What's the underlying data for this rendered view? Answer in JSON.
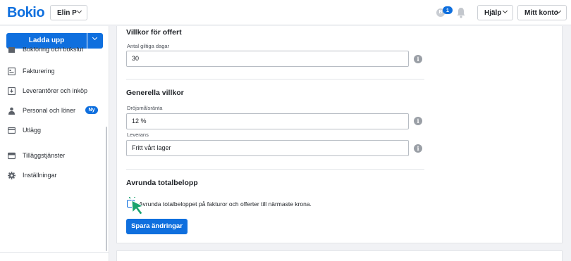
{
  "header": {
    "logo": "Bokio",
    "user": "Elin P",
    "coin_symbol": "B",
    "notification_count": "1",
    "help": "Hjälp",
    "account": "Mitt konto"
  },
  "sidebar": {
    "upload": "Ladda upp",
    "items": [
      {
        "label": "Bokföring och bokslut",
        "icon": "book-icon"
      },
      {
        "label": "Fakturering",
        "icon": "invoice-icon"
      },
      {
        "label": "Leverantörer och inköp",
        "icon": "supplier-icon"
      },
      {
        "label": "Personal och löner",
        "icon": "person-icon",
        "badge": "Ny"
      },
      {
        "label": "Utlägg",
        "icon": "card-icon"
      },
      {
        "label": "Tilläggstjänster",
        "icon": "services-icon"
      },
      {
        "label": "Inställningar",
        "icon": "gear-icon"
      }
    ]
  },
  "main": {
    "offer_title": "Villkor för offert",
    "valid_days_label": "Antal giltiga dagar",
    "valid_days_value": "30",
    "general_title": "Generella villkor",
    "late_interest_label": "Dröjsmålsränta",
    "late_interest_value": "12 %",
    "delivery_label": "Leverans",
    "delivery_value": "Fritt vårt lager",
    "rounding_title": "Avrunda totalbelopp",
    "rounding_checkbox_label": "Avrunda totalbeloppet på fakturor och offerter till närmaste krona.",
    "rounding_checked": false,
    "save_button": "Spara ändringar",
    "info_symbol": "i"
  },
  "colors": {
    "accent": "#0f6fde",
    "cursor": "#1aa36f"
  }
}
